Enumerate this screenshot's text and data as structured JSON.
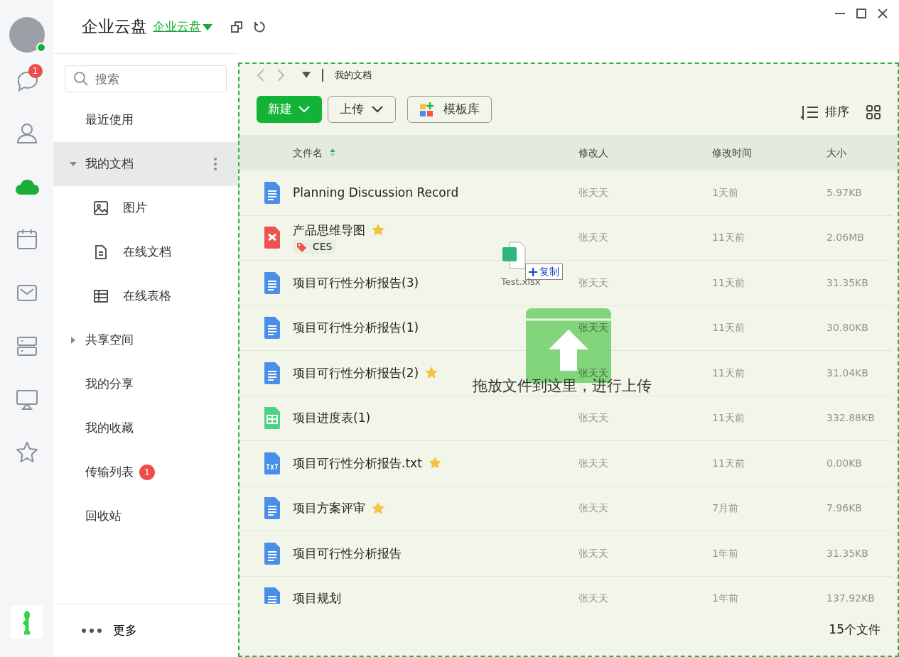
{
  "window": {
    "title": "企业云盘",
    "space_switcher": "企业云盘"
  },
  "rail": {
    "items": [
      {
        "kind": "chat",
        "selected": false,
        "badge": "1"
      },
      {
        "kind": "contacts",
        "selected": false
      },
      {
        "kind": "cloud",
        "selected": true
      },
      {
        "kind": "calendar",
        "selected": false
      },
      {
        "kind": "mail",
        "selected": false
      },
      {
        "kind": "server",
        "selected": false
      },
      {
        "kind": "screen",
        "selected": false
      },
      {
        "kind": "star",
        "selected": false
      }
    ]
  },
  "sidebar": {
    "search": {
      "placeholder": "搜索"
    },
    "items": [
      {
        "label": "最近使用",
        "selected": false
      },
      {
        "label": "我的文档",
        "selected": true,
        "expanded": true,
        "children": [
          {
            "label": "图片",
            "kind": "image",
            "selected": false
          },
          {
            "label": "在线文档",
            "kind": "doc",
            "selected": false
          },
          {
            "label": "在线表格",
            "kind": "sheet",
            "selected": false
          }
        ]
      },
      {
        "label": "共享空间",
        "selected": false,
        "expanded": false
      },
      {
        "label": "我的分享",
        "selected": false
      },
      {
        "label": "我的收藏",
        "selected": false
      },
      {
        "label": "传输列表",
        "selected": false,
        "badge": "1"
      },
      {
        "label": "回收站",
        "selected": false
      }
    ],
    "more": "更多"
  },
  "breadcrumb": "我的文档",
  "toolbar": {
    "new": "新建",
    "upload": "上传",
    "templates": "模板库",
    "sort": "排序"
  },
  "table": {
    "columns": [
      {
        "label": "文件名",
        "sorted": true
      },
      {
        "label": "修改人",
        "sorted": false
      },
      {
        "label": "修改时间",
        "sorted": false
      },
      {
        "label": "大小",
        "sorted": false
      }
    ],
    "rows": [
      {
        "name": "Planning Discussion Record",
        "kind": "doc",
        "starred": false,
        "modifier": "张天天",
        "time": "1天前",
        "size": "5.97KB"
      },
      {
        "name": "产品思维导图",
        "kind": "mindmap",
        "starred": true,
        "tags": [
          "CES"
        ],
        "modifier": "张天天",
        "time": "11天前",
        "size": "2.06MB"
      },
      {
        "name": "项目可行性分析报告(3)",
        "kind": "doc",
        "starred": false,
        "modifier": "张天天",
        "time": "11天前",
        "size": "31.35KB"
      },
      {
        "name": "项目可行性分析报告(1)",
        "kind": "doc",
        "starred": false,
        "modifier": "张天天",
        "time": "11天前",
        "size": "30.80KB"
      },
      {
        "name": "项目可行性分析报告(2)",
        "kind": "doc",
        "starred": true,
        "modifier": "张天天",
        "time": "11天前",
        "size": "31.04KB"
      },
      {
        "name": "项目进度表(1)",
        "kind": "sheet",
        "starred": false,
        "modifier": "张天天",
        "time": "11天前",
        "size": "332.88KB"
      },
      {
        "name": "项目可行性分析报告.txt",
        "kind": "txt",
        "starred": true,
        "modifier": "张天天",
        "time": "11天前",
        "size": "0.00KB"
      },
      {
        "name": "项目方案评审",
        "kind": "doc",
        "starred": true,
        "modifier": "张天天",
        "time": "7月前",
        "size": "7.96KB"
      },
      {
        "name": "项目可行性分析报告",
        "kind": "doc",
        "starred": false,
        "modifier": "张天天",
        "time": "1年前",
        "size": "31.35KB"
      },
      {
        "name": "项目规划",
        "kind": "doc",
        "starred": false,
        "modifier": "张天天",
        "time": "1年前",
        "size": "137.92KB"
      }
    ]
  },
  "file_count": "15个文件",
  "drag": {
    "file_name": "Test.xlsx",
    "action": "复制"
  },
  "drop_zone": {
    "message": "拖放文件到这里，进行上传"
  }
}
